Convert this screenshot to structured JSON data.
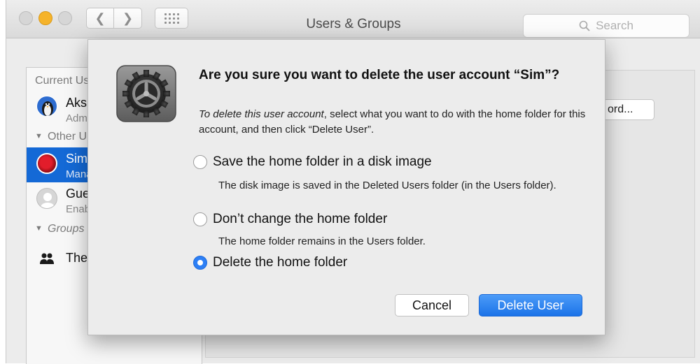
{
  "window": {
    "title": "Users & Groups",
    "search_placeholder": "Search"
  },
  "sidebar": {
    "current_users_header": "Current Us",
    "current_user": {
      "name": "Aksh",
      "role": "Admi"
    },
    "other_users_header": "Other U",
    "selected_user": {
      "name": "Sim",
      "role": "Mana"
    },
    "guest_user": {
      "name": "Gue",
      "status": "Enab"
    },
    "groups_header": "Groups",
    "group_item": "The"
  },
  "pane": {
    "password_button_partial": "ord..."
  },
  "dialog": {
    "heading": "Are you sure you want to delete the user account “Sim”?",
    "instructions_italic": "To delete this user account",
    "instructions_rest": ", select what you want to do with the home folder for this account, and then click “Delete User”.",
    "options": [
      {
        "label": "Save the home folder in a disk image",
        "description": "The disk image is saved in the Deleted Users folder (in the Users folder).",
        "selected": false
      },
      {
        "label": "Don’t change the home folder",
        "description": "The home folder remains in the Users folder.",
        "selected": false
      },
      {
        "label": "Delete the home folder",
        "description": "",
        "selected": true
      }
    ],
    "cancel_label": "Cancel",
    "delete_label": "Delete User"
  },
  "colors": {
    "accent": "#1b73e8",
    "selection": "#1469d6",
    "minimize": "#f5b32a"
  }
}
